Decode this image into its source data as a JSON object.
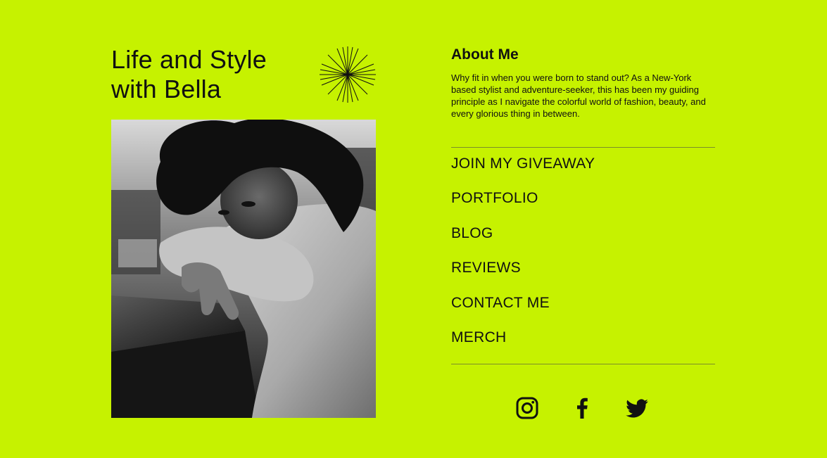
{
  "hero": {
    "title": "Life and Style\nwith Bella",
    "photo_alt": "Black and white portrait of Bella"
  },
  "about": {
    "heading": "About Me",
    "text": "Why fit in when you were born to stand out? As a New-York based stylist and adventure-seeker, this has been my guiding principle as I navigate the colorful world of fashion, beauty, and every glorious thing in between."
  },
  "nav": {
    "items": [
      {
        "label": "JOIN MY GIVEAWAY"
      },
      {
        "label": "PORTFOLIO"
      },
      {
        "label": "BLOG"
      },
      {
        "label": "REVIEWS"
      },
      {
        "label": "CONTACT ME"
      },
      {
        "label": "MERCH"
      }
    ]
  },
  "social": {
    "icons": [
      "instagram-icon",
      "facebook-icon",
      "twitter-icon"
    ]
  },
  "colors": {
    "background": "#c6f200",
    "text": "#111111",
    "divider": "#7c8f2a"
  }
}
